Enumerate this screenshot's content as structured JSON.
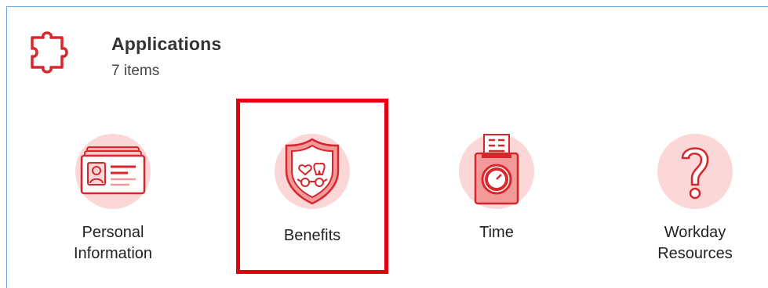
{
  "header": {
    "title": "Applications",
    "count": "7 items",
    "icon": "puzzle-icon"
  },
  "apps": [
    {
      "name_line1": "Personal",
      "name_line2": "Information",
      "icon": "id-card-icon"
    },
    {
      "name_line1": "Benefits",
      "name_line2": "",
      "icon": "benefits-shield-icon"
    },
    {
      "name_line1": "Time",
      "name_line2": "",
      "icon": "time-clock-icon"
    },
    {
      "name_line1": "Workday",
      "name_line2": "Resources",
      "icon": "question-icon"
    }
  ],
  "colors": {
    "accent": "#d8262d",
    "icon_bg": "#fbd7d7",
    "border": "#6aa0dc",
    "highlight": "#e3000f"
  }
}
